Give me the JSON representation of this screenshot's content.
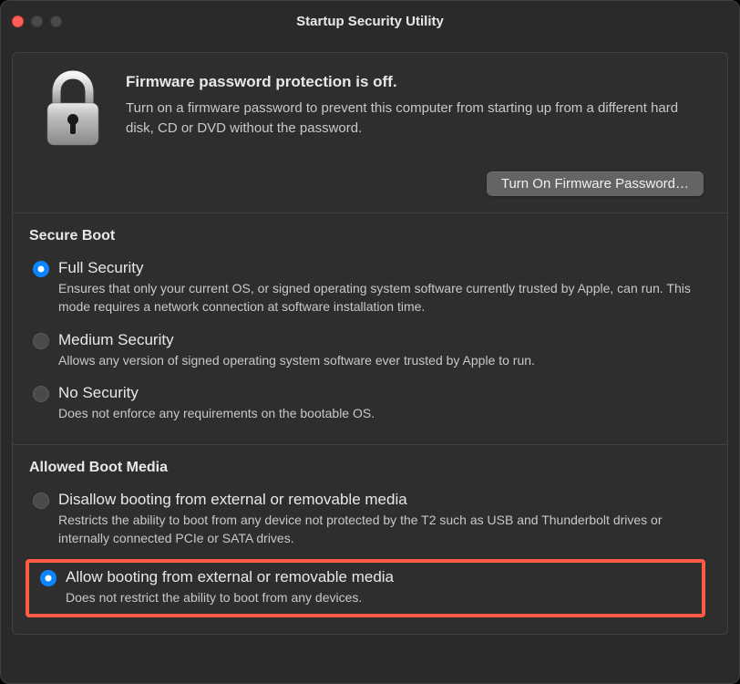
{
  "window": {
    "title": "Startup Security Utility"
  },
  "firmware": {
    "title": "Firmware password protection is off.",
    "description": "Turn on a firmware password to prevent this computer from starting up from a different hard disk, CD or DVD without the password.",
    "button_label": "Turn On Firmware Password…"
  },
  "secure_boot": {
    "title": "Secure Boot",
    "options": [
      {
        "label": "Full Security",
        "description": "Ensures that only your current OS, or signed operating system software currently trusted by Apple, can run. This mode requires a network connection at software installation time.",
        "selected": true
      },
      {
        "label": "Medium Security",
        "description": "Allows any version of signed operating system software ever trusted by Apple to run.",
        "selected": false
      },
      {
        "label": "No Security",
        "description": "Does not enforce any requirements on the bootable OS.",
        "selected": false
      }
    ]
  },
  "allowed_boot_media": {
    "title": "Allowed Boot Media",
    "options": [
      {
        "label": "Disallow booting from external or removable media",
        "description": "Restricts the ability to boot from any device not protected by the T2 such as USB and Thunderbolt drives or internally connected PCIe or SATA drives.",
        "selected": false
      },
      {
        "label": "Allow booting from external or removable media",
        "description": "Does not restrict the ability to boot from any devices.",
        "selected": true
      }
    ]
  }
}
